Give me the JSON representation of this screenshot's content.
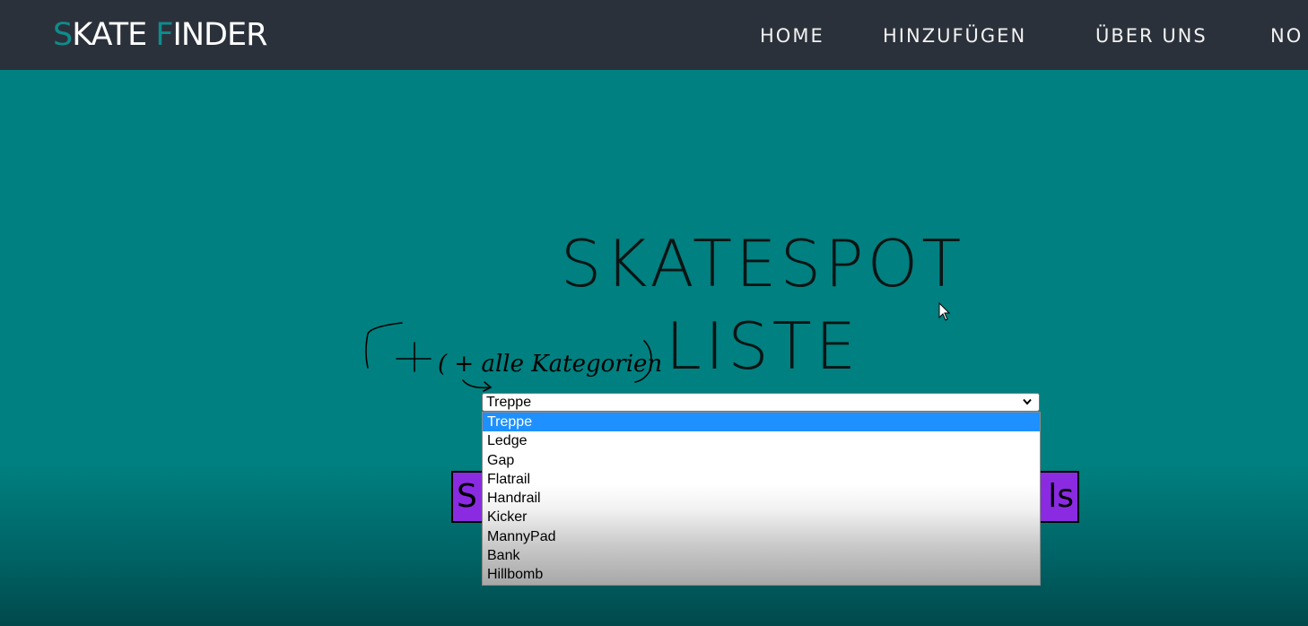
{
  "navbar": {
    "logo_first_accent": "S",
    "logo_first_rest": "KATE ",
    "logo_second_accent": "F",
    "logo_second_rest": "INDER",
    "links": [
      "HOME",
      "HINZUFÜGEN",
      "ÜBER UNS",
      "NO"
    ]
  },
  "hero": {
    "title_line1": "SKATESPOT",
    "title_line2": "LISTE",
    "annotation_text": "( + alle Kategorien )"
  },
  "select": {
    "current_value": "Treppe",
    "options": [
      "Treppe",
      "Ledge",
      "Gap",
      "Flatrail",
      "Handrail",
      "Kicker",
      "MannyPad",
      "Bank",
      "Hillbomb"
    ],
    "selected_index": 0
  },
  "purple_button": {
    "visible_left": "S",
    "visible_right": "ls"
  },
  "colors": {
    "navbar_bg": "#2b313b",
    "teal_bg": "#008080",
    "logo_accent": "#0e8c8c",
    "option_selected": "#1e90ff",
    "purple": "#8a2be2"
  }
}
